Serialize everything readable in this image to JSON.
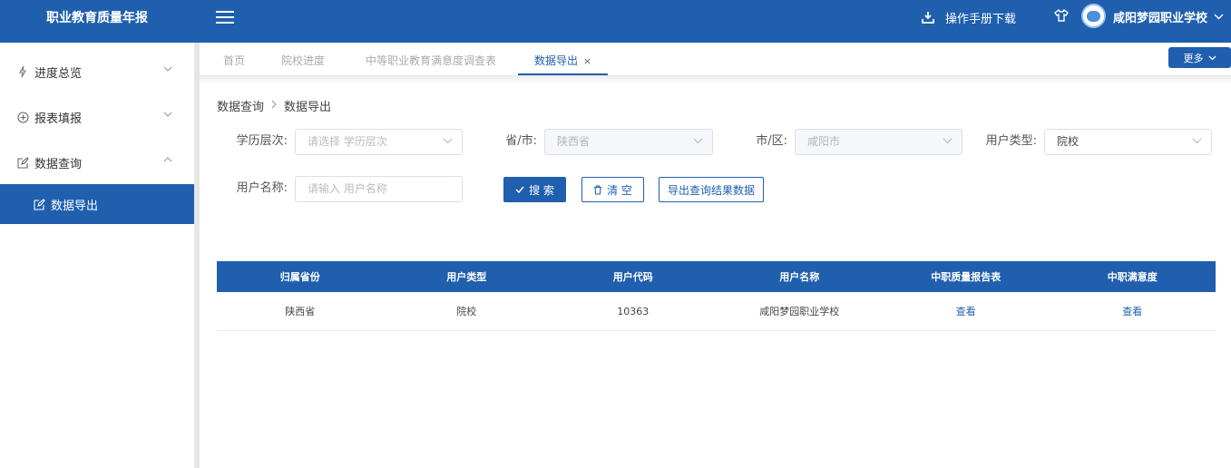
{
  "header": {
    "brand": "职业教育质量年报",
    "manual_download": "操作手册下载",
    "school_name": "咸阳梦园职业学校"
  },
  "sidebar": {
    "items": [
      {
        "label": "进度总览",
        "icon": "bolt-icon",
        "expanded": false
      },
      {
        "label": "报表填报",
        "icon": "plus-circle-icon",
        "expanded": false
      },
      {
        "label": "数据查询",
        "icon": "edit-icon",
        "expanded": true
      },
      {
        "label": "数据导出",
        "icon": "edit-icon",
        "active": true
      }
    ]
  },
  "tabs": [
    {
      "label": "首页"
    },
    {
      "label": "院校进度"
    },
    {
      "label": "中等职业教育满意度调查表"
    },
    {
      "label": "数据导出",
      "active": true,
      "close": "×"
    }
  ],
  "more_button": "更多",
  "breadcrumb": [
    "数据查询",
    "数据导出"
  ],
  "filters": {
    "edu_level": {
      "label": "学历层次:",
      "placeholder": "请选择 学历层次"
    },
    "province": {
      "label": "省/市:",
      "value": "陕西省"
    },
    "city": {
      "label": "市/区:",
      "value": "咸阳市"
    },
    "user_type": {
      "label": "用户类型:",
      "value": "院校"
    },
    "user_name": {
      "label": "用户名称:",
      "placeholder": "请输入 用户名称"
    }
  },
  "buttons": {
    "search": "搜 索",
    "clear": "清 空",
    "export": "导出查询结果数据"
  },
  "table": {
    "headers": [
      "归属省份",
      "用户类型",
      "用户代码",
      "用户名称",
      "中职质量报告表",
      "中职满意度"
    ],
    "rows": [
      [
        "陕西省",
        "院校",
        "10363",
        "咸阳梦园职业学校",
        "查看",
        "查看"
      ]
    ]
  },
  "colors": {
    "primary": "#1f5fae"
  }
}
